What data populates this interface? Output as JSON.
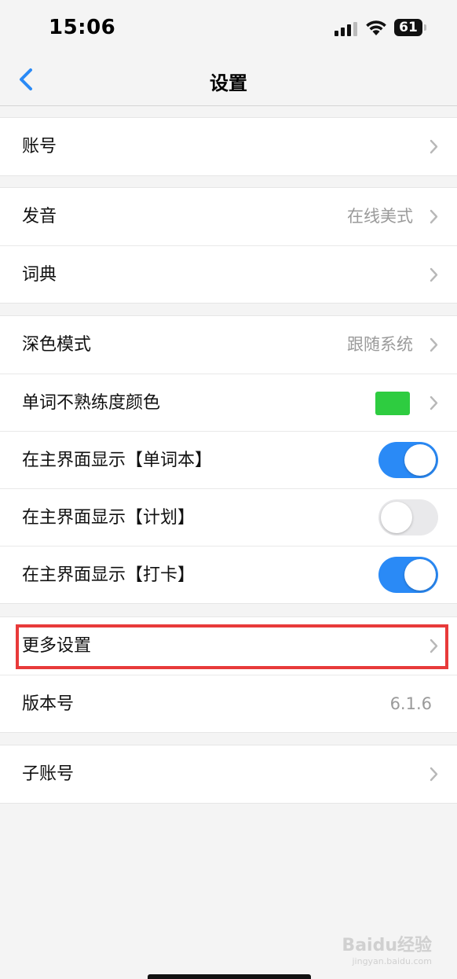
{
  "status_bar": {
    "time": "15:06",
    "battery": "61"
  },
  "nav": {
    "title": "设置"
  },
  "groups": [
    {
      "rows": [
        {
          "label": "账号"
        }
      ]
    },
    {
      "rows": [
        {
          "label": "发音",
          "value": "在线美式"
        },
        {
          "label": "词典"
        }
      ]
    },
    {
      "rows": [
        {
          "label": "深色模式",
          "value": "跟随系统"
        },
        {
          "label": "单词不熟练度颜色",
          "swatch_color": "#2ecc40"
        },
        {
          "label": "在主界面显示【单词本】",
          "toggle": true
        },
        {
          "label": "在主界面显示【计划】",
          "toggle": false
        },
        {
          "label": "在主界面显示【打卡】",
          "toggle": true
        }
      ]
    },
    {
      "rows": [
        {
          "label": "更多设置"
        },
        {
          "label": "版本号",
          "value": "6.1.6"
        }
      ]
    },
    {
      "rows": [
        {
          "label": "子账号"
        }
      ]
    }
  ],
  "colors": {
    "accent": "#2a8af6",
    "highlight": "#e83a3a"
  },
  "watermark": {
    "text": "Baidu经验",
    "sub": "jingyan.baidu.com"
  }
}
